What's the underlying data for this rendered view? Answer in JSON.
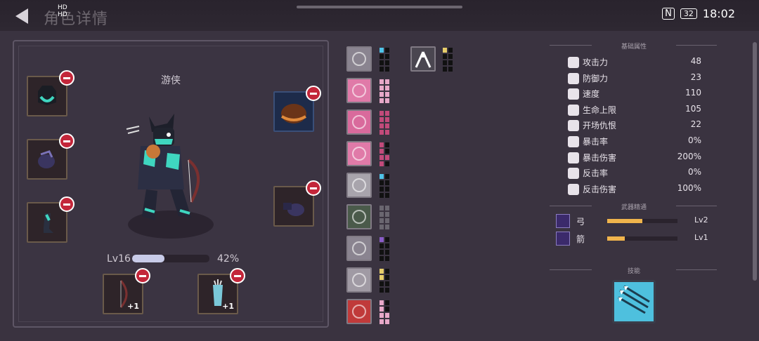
{
  "header": {
    "title": "角色详情",
    "time": "18:02",
    "battery": "32",
    "signal_text_1": "HD",
    "signal_text_2": "HD"
  },
  "hero": {
    "class_name": "游侠",
    "level": "Lv16",
    "exp_percent": "42%",
    "exp_fraction": 0.42
  },
  "equipment": {
    "plus_1": "+1",
    "plus_2": "+1"
  },
  "sections": {
    "base_attributes": "基础属性",
    "weapon_mastery": "武器精通",
    "skills": "技能"
  },
  "stats": [
    {
      "icon": "sword-icon",
      "label": "攻击力",
      "value": "48"
    },
    {
      "icon": "shield-icon",
      "label": "防御力",
      "value": "23"
    },
    {
      "icon": "boot-icon",
      "label": "速度",
      "value": "110"
    },
    {
      "icon": "heart-icon",
      "label": "生命上限",
      "value": "105"
    },
    {
      "icon": "skull-icon",
      "label": "开场仇恨",
      "value": "22"
    },
    {
      "icon": "burst-icon",
      "label": "暴击率",
      "value": "0%"
    },
    {
      "icon": "crossed-swords-icon",
      "label": "暴击伤害",
      "value": "200%"
    },
    {
      "icon": "counter-icon",
      "label": "反击率",
      "value": "0%"
    },
    {
      "icon": "spiral-icon",
      "label": "反击伤害",
      "value": "100%"
    }
  ],
  "mastery": [
    {
      "label": "弓",
      "level": "Lv2",
      "fraction": 0.5
    },
    {
      "label": "箭",
      "level": "Lv1",
      "fraction": 0.25
    }
  ],
  "colors": {
    "accent": "#f0b44c",
    "remove": "#c3263a",
    "pink": "#e07aa8",
    "cyan": "#4fc3e8",
    "yellow": "#e6cd6a",
    "purple": "#8a5cc8"
  }
}
